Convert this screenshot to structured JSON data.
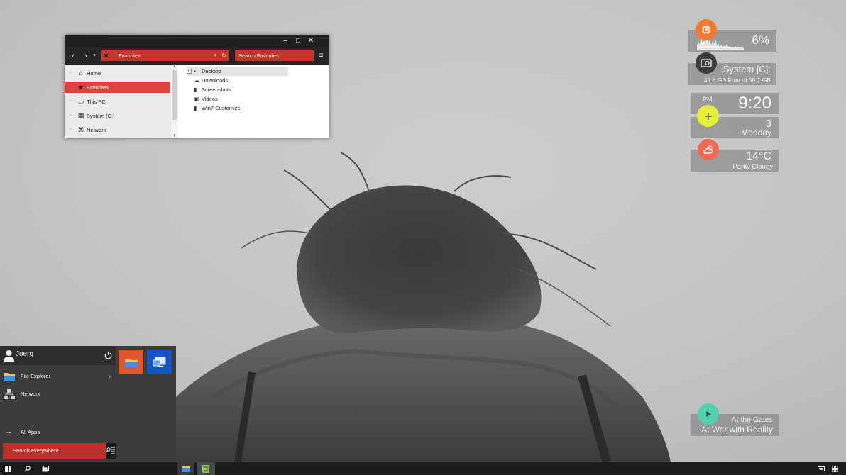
{
  "explorer": {
    "window_controls": {
      "minimize": "–",
      "maximize": "□",
      "close": "✕"
    },
    "nav": {
      "back": "‹",
      "forward": "›",
      "recent": "▾"
    },
    "address": {
      "path": "Favorites",
      "dropdown": "▾",
      "refresh": "↻"
    },
    "search_placeholder": "Search Favorites",
    "menu_icon": "≡",
    "nav_items": [
      {
        "label": "Home",
        "icon": "⌂",
        "arrow": "›"
      },
      {
        "label": "Favorites",
        "icon": "★",
        "arrow": ""
      },
      {
        "label": "This PC",
        "icon": "▭",
        "arrow": "›"
      },
      {
        "label": "System (C:)",
        "icon": "▦",
        "arrow": "›"
      },
      {
        "label": "Network",
        "icon": "⌘",
        "arrow": "›"
      }
    ],
    "scroll_up": "▲",
    "scroll_down": "▼",
    "files": [
      {
        "label": "Desktop",
        "icon": "▪",
        "check": "✓"
      },
      {
        "label": "Downloads",
        "icon": "☁"
      },
      {
        "label": "Screenshots",
        "icon": "▮"
      },
      {
        "label": "Videos",
        "icon": "▣"
      },
      {
        "label": "Win7 Customize",
        "icon": "▮"
      }
    ]
  },
  "widgets": {
    "cpu": {
      "value": "6%",
      "icon": "cpu-chip-icon",
      "circle_color": "#f07a30"
    },
    "drive": {
      "title": "System [C]:",
      "detail": "41.8 GB Free of 59.7 GB",
      "icon": "hard-drive-icon",
      "circle_color": "#3d3d3d"
    },
    "clock": {
      "period": "PM",
      "time": "9:20",
      "day_number": "3",
      "day_name": "Monday",
      "icon": "plus-icon",
      "circle_color": "#e4ef3a"
    },
    "weather": {
      "temperature": "14°C",
      "condition": "Partly Cloudy",
      "icon": "cloud-sun-icon",
      "circle_color": "#ee6a52"
    },
    "music": {
      "track": "At the Gates",
      "album": "At War with Reality",
      "icon": "play-icon",
      "circle_color": "#56cfae"
    }
  },
  "start_menu": {
    "user_name": "Joerg",
    "items": [
      {
        "label": "File Explorer",
        "chevron": "›"
      },
      {
        "label": "Network",
        "chevron": ""
      }
    ],
    "all_apps": "All Apps",
    "all_apps_arrow": "→",
    "search_placeholder": "Search everywhere"
  }
}
